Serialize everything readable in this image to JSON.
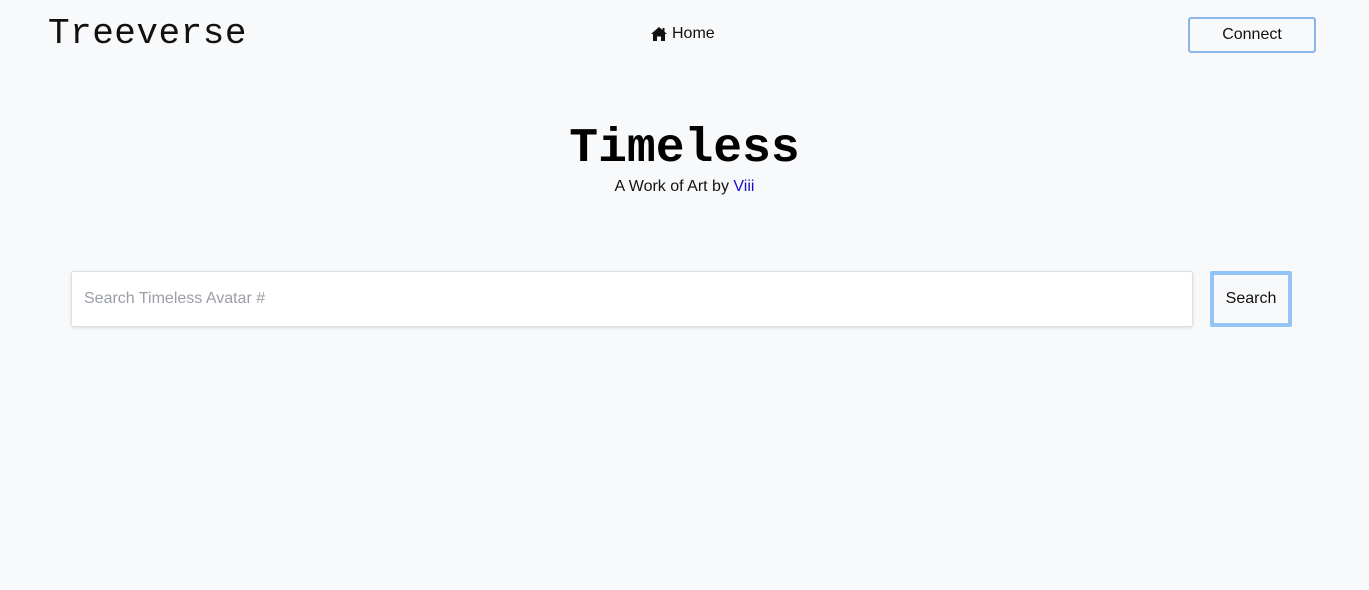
{
  "header": {
    "logo": "Treeverse",
    "nav_home_label": "Home",
    "nav_home_icon": "home-icon",
    "connect_label": "Connect"
  },
  "hero": {
    "title": "Timeless",
    "subtitle_prefix": "A Work of Art by",
    "artist": "Viii"
  },
  "search": {
    "placeholder": "Search Timeless Avatar #",
    "value": "",
    "button_label": "Search"
  },
  "colors": {
    "background": "#f8f9fb",
    "connect_border": "#8ab4ea",
    "search_button_border": "#93c4f5",
    "link": "#1a0dcc"
  }
}
